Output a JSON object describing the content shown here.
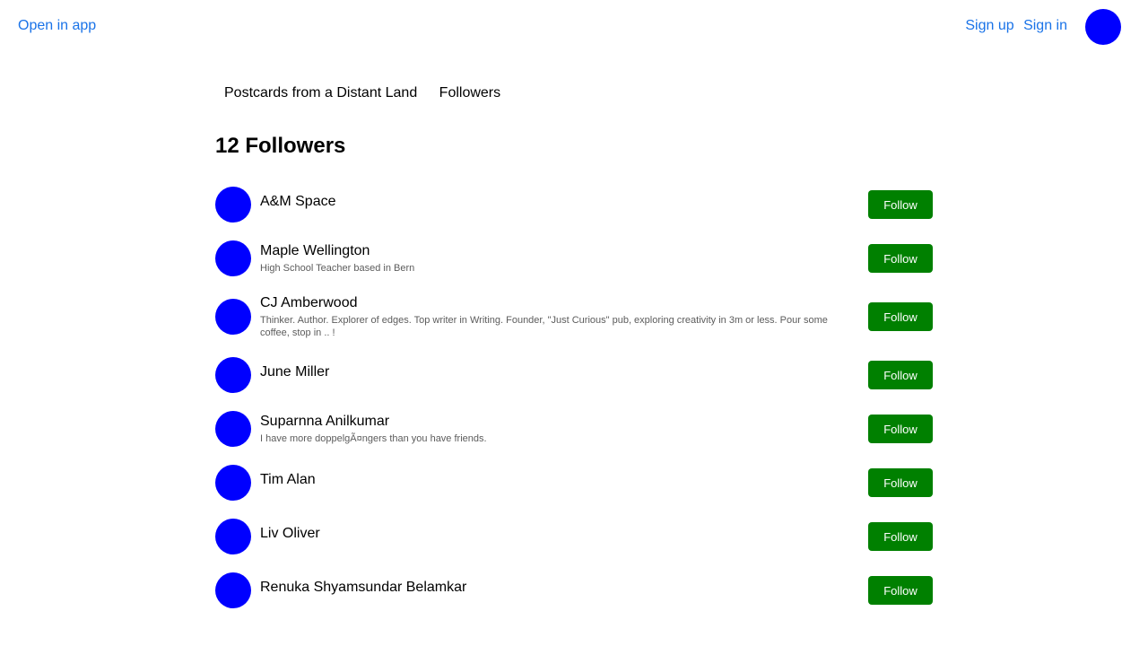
{
  "colors": {
    "link": "#1a73e8",
    "avatar": "#0000ff",
    "follow_button": "#008000"
  },
  "header": {
    "open_in_app": "Open in app",
    "sign_up": "Sign up",
    "sign_in": "Sign in"
  },
  "subnav": {
    "publication": "Postcards from a Distant Land",
    "followers": "Followers"
  },
  "page_title": "12 Followers",
  "followers": [
    {
      "name": "A&M Space",
      "bio": "",
      "button": "Follow"
    },
    {
      "name": "Maple Wellington",
      "bio": "High School Teacher based in Bern",
      "button": "Follow"
    },
    {
      "name": "CJ Amberwood",
      "bio": "Thinker. Author. Explorer of edges. Top writer in Writing. Founder, \"Just Curious\" pub, exploring creativity in 3m or less. Pour some coffee, stop in .. !",
      "button": "Follow"
    },
    {
      "name": "June Miller",
      "bio": "",
      "button": "Follow"
    },
    {
      "name": "Suparnna Anilkumar",
      "bio": "I have more doppelgÃ¤ngers than you have friends.",
      "button": "Follow"
    },
    {
      "name": "Tim Alan",
      "bio": "",
      "button": "Follow"
    },
    {
      "name": "Liv Oliver",
      "bio": "",
      "button": "Follow"
    },
    {
      "name": "Renuka Shyamsundar Belamkar",
      "bio": "",
      "button": "Follow"
    }
  ]
}
